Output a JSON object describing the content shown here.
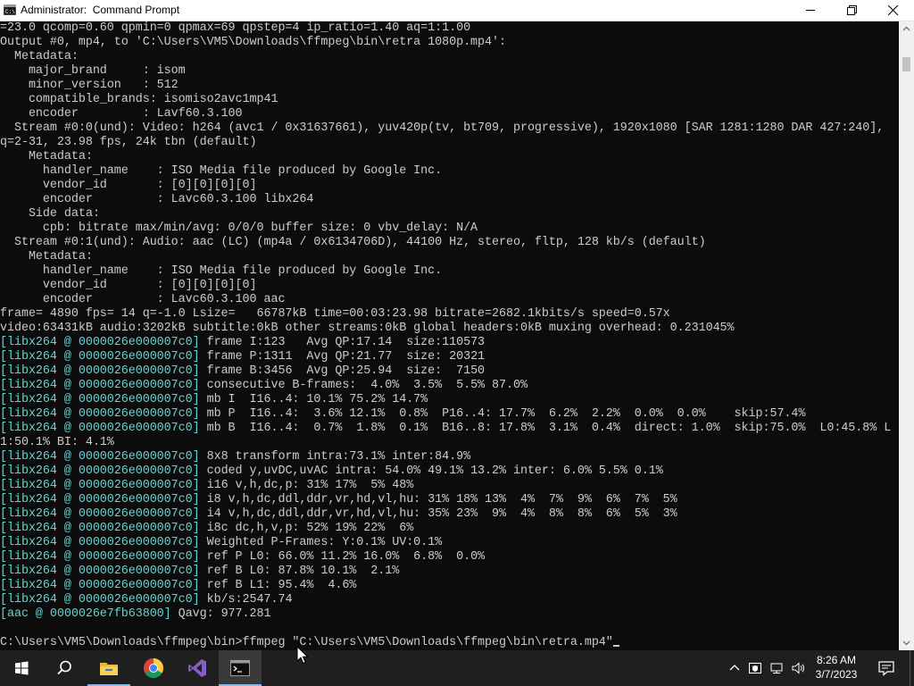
{
  "window": {
    "title": "Administrator:  Command Prompt",
    "app_icon": "cmd-icon",
    "controls": {
      "minimize_icon": "minimize-icon",
      "maximize_icon": "restore-icon",
      "close_icon": "close-icon"
    }
  },
  "console": {
    "colors": {
      "background": "#0c0c0c",
      "text": "#cccccc",
      "highlight": "#5fd7d7"
    },
    "lines": [
      {
        "text": "=23.0 qcomp=0.60 qpmin=0 qpmax=69 qpstep=4 ip_ratio=1.40 aq=1:1.00"
      },
      {
        "text": "Output #0, mp4, to 'C:\\Users\\VM5\\Downloads\\ffmpeg\\bin\\retra 1080p.mp4':"
      },
      {
        "text": "  Metadata:"
      },
      {
        "text": "    major_brand     : isom"
      },
      {
        "text": "    minor_version   : 512"
      },
      {
        "text": "    compatible_brands: isomiso2avc1mp41"
      },
      {
        "text": "    encoder         : Lavf60.3.100"
      },
      {
        "text": "  Stream #0:0(und): Video: h264 (avc1 / 0x31637661), yuv420p(tv, bt709, progressive), 1920x1080 [SAR 1281:1280 DAR 427:240],"
      },
      {
        "text": "q=2-31, 23.98 fps, 24k tbn (default)"
      },
      {
        "text": "    Metadata:"
      },
      {
        "text": "      handler_name    : ISO Media file produced by Google Inc."
      },
      {
        "text": "      vendor_id       : [0][0][0][0]"
      },
      {
        "text": "      encoder         : Lavc60.3.100 libx264"
      },
      {
        "text": "    Side data:"
      },
      {
        "text": "      cpb: bitrate max/min/avg: 0/0/0 buffer size: 0 vbv_delay: N/A"
      },
      {
        "text": "  Stream #0:1(und): Audio: aac (LC) (mp4a / 0x6134706D), 44100 Hz, stereo, fltp, 128 kb/s (default)"
      },
      {
        "text": "    Metadata:"
      },
      {
        "text": "      handler_name    : ISO Media file produced by Google Inc."
      },
      {
        "text": "      vendor_id       : [0][0][0][0]"
      },
      {
        "text": "      encoder         : Lavc60.3.100 aac"
      },
      {
        "text": "frame= 4890 fps= 14 q=-1.0 Lsize=   66787kB time=00:03:23.98 bitrate=2682.1kbits/s speed=0.57x"
      },
      {
        "text": "video:63431kB audio:3202kB subtitle:0kB other streams:0kB global headers:0kB muxing overhead: 0.231045%"
      },
      {
        "prefix": "[libx264 @ 0000026e000007c0]",
        "text": " frame I:123   Avg QP:17.14  size:110573"
      },
      {
        "prefix": "[libx264 @ 0000026e000007c0]",
        "text": " frame P:1311  Avg QP:21.77  size: 20321"
      },
      {
        "prefix": "[libx264 @ 0000026e000007c0]",
        "text": " frame B:3456  Avg QP:25.94  size:  7150"
      },
      {
        "prefix": "[libx264 @ 0000026e000007c0]",
        "text": " consecutive B-frames:  4.0%  3.5%  5.5% 87.0%"
      },
      {
        "prefix": "[libx264 @ 0000026e000007c0]",
        "text": " mb I  I16..4: 10.1% 75.2% 14.7%"
      },
      {
        "prefix": "[libx264 @ 0000026e000007c0]",
        "text": " mb P  I16..4:  3.6% 12.1%  0.8%  P16..4: 17.7%  6.2%  2.2%  0.0%  0.0%    skip:57.4%"
      },
      {
        "prefix": "[libx264 @ 0000026e000007c0]",
        "text": " mb B  I16..4:  0.7%  1.8%  0.1%  B16..8: 17.8%  3.1%  0.4%  direct: 1.0%  skip:75.0%  L0:45.8% L"
      },
      {
        "text": "1:50.1% BI: 4.1%"
      },
      {
        "prefix": "[libx264 @ 0000026e000007c0]",
        "text": " 8x8 transform intra:73.1% inter:84.9%"
      },
      {
        "prefix": "[libx264 @ 0000026e000007c0]",
        "text": " coded y,uvDC,uvAC intra: 54.0% 49.1% 13.2% inter: 6.0% 5.5% 0.1%"
      },
      {
        "prefix": "[libx264 @ 0000026e000007c0]",
        "text": " i16 v,h,dc,p: 31% 17%  5% 48%"
      },
      {
        "prefix": "[libx264 @ 0000026e000007c0]",
        "text": " i8 v,h,dc,ddl,ddr,vr,hd,vl,hu: 31% 18% 13%  4%  7%  9%  6%  7%  5%"
      },
      {
        "prefix": "[libx264 @ 0000026e000007c0]",
        "text": " i4 v,h,dc,ddl,ddr,vr,hd,vl,hu: 35% 23%  9%  4%  8%  8%  6%  5%  3%"
      },
      {
        "prefix": "[libx264 @ 0000026e000007c0]",
        "text": " i8c dc,h,v,p: 52% 19% 22%  6%"
      },
      {
        "prefix": "[libx264 @ 0000026e000007c0]",
        "text": " Weighted P-Frames: Y:0.1% UV:0.1%"
      },
      {
        "prefix": "[libx264 @ 0000026e000007c0]",
        "text": " ref P L0: 66.0% 11.2% 16.0%  6.8%  0.0%"
      },
      {
        "prefix": "[libx264 @ 0000026e000007c0]",
        "text": " ref B L0: 87.8% 10.1%  2.1%"
      },
      {
        "prefix": "[libx264 @ 0000026e000007c0]",
        "text": " ref B L1: 95.4%  4.6%"
      },
      {
        "prefix": "[libx264 @ 0000026e000007c0]",
        "text": " kb/s:2547.74"
      },
      {
        "prefix": "[aac @ 0000026e7fb63800]",
        "text": " Qavg: 977.281"
      },
      {
        "text": ""
      }
    ],
    "prompt": "C:\\Users\\VM5\\Downloads\\ffmpeg\\bin>",
    "command": "ffmpeg \"C:\\Users\\VM5\\Downloads\\ffmpeg\\bin\\retra.mp4\""
  },
  "taskbar": {
    "apps": [
      {
        "name": "start",
        "icon": "windows-start-icon"
      },
      {
        "name": "search",
        "icon": "search-icon"
      },
      {
        "name": "file-explorer",
        "icon": "folder-icon"
      },
      {
        "name": "chrome",
        "icon": "chrome-icon"
      },
      {
        "name": "visual-studio",
        "icon": "visual-studio-icon"
      },
      {
        "name": "command-prompt",
        "icon": "cmd-icon",
        "active": true
      }
    ],
    "tray_icons": [
      "chevron-up-icon",
      "security-icon",
      "network-icon",
      "volume-icon"
    ],
    "clock": {
      "time": "8:26 AM",
      "date": "3/7/2023"
    },
    "notification_icon": "notification-icon"
  }
}
